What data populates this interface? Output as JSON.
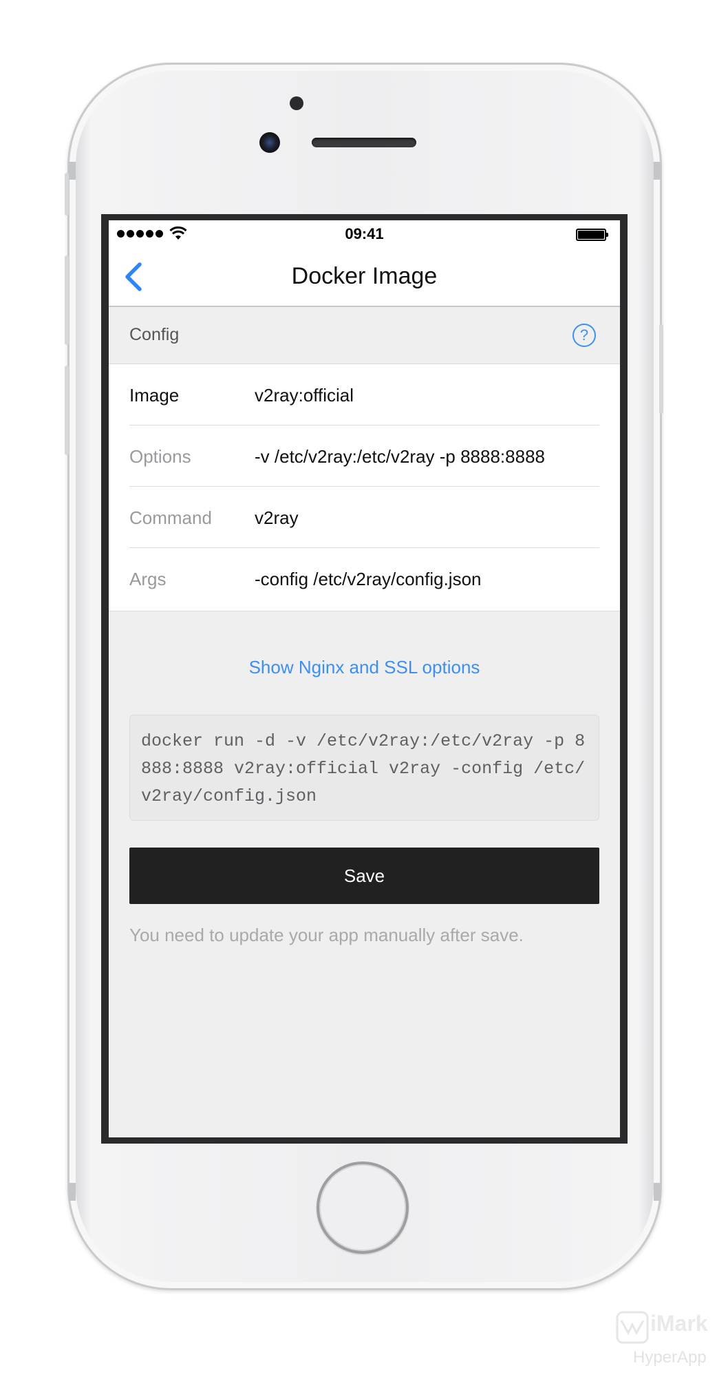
{
  "status_bar": {
    "time": "09:41"
  },
  "nav": {
    "title": "Docker Image"
  },
  "section": {
    "title": "Config"
  },
  "fields": [
    {
      "label": "Image",
      "value": "v2ray:official"
    },
    {
      "label": "Options",
      "value": "-v /etc/v2ray:/etc/v2ray -p 8888:8888"
    },
    {
      "label": "Command",
      "value": "v2ray"
    },
    {
      "label": "Args",
      "value": "-config /etc/v2ray/config.json"
    }
  ],
  "nginx_link": "Show Nginx and SSL options",
  "command_preview": "docker run -d -v /etc/v2ray:/etc/v2ray -p 8888:8888 v2ray:official v2ray -config /etc/v2ray/config.json",
  "save_label": "Save",
  "save_note": "You need to update your app manually after save.",
  "watermark": {
    "title": "iMark",
    "subtitle": "HyperApp"
  },
  "colors": {
    "accent": "#3d8ff0",
    "button": "#212121",
    "background": "#efeff0"
  }
}
